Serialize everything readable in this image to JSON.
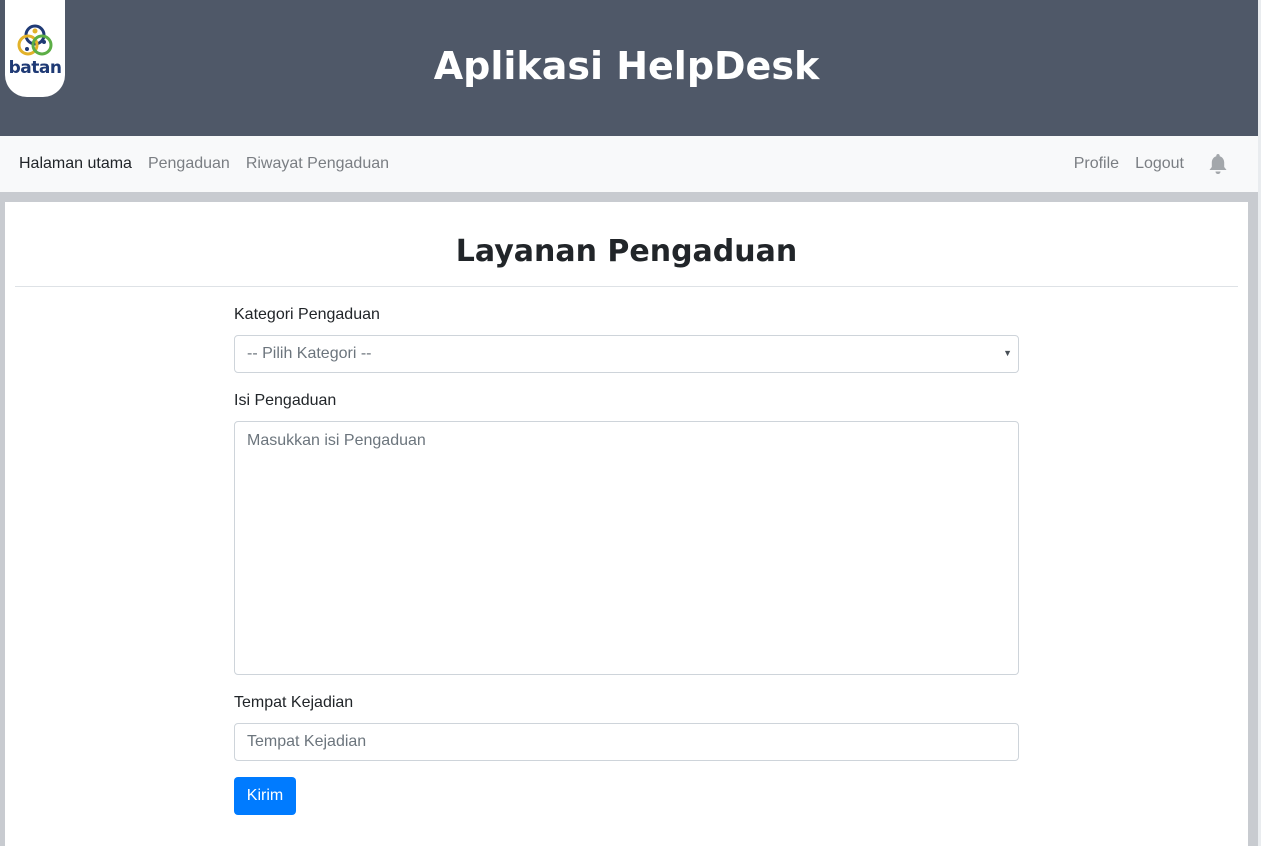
{
  "header": {
    "logo_text": "batan",
    "app_title": "Aplikasi HelpDesk"
  },
  "navbar": {
    "left_items": [
      {
        "label": "Halaman utama",
        "active": true
      },
      {
        "label": "Pengaduan",
        "active": false
      },
      {
        "label": "Riwayat Pengaduan",
        "active": false
      }
    ],
    "right_items": [
      {
        "label": "Profile"
      },
      {
        "label": "Logout"
      }
    ],
    "notification_icon": "bell-icon"
  },
  "form": {
    "title": "Layanan Pengaduan",
    "category_label": "Kategori Pengaduan",
    "category_selected": "-- Pilih Kategori --",
    "content_label": "Isi Pengaduan",
    "content_placeholder": "Masukkan isi Pengaduan",
    "location_label": "Tempat Kejadian",
    "location_placeholder": "Tempat Kejadian",
    "submit_label": "Kirim"
  },
  "colors": {
    "header_bg": "#4f5868",
    "navbar_bg": "#f8f9fa",
    "primary": "#007bff",
    "page_bg": "#c8cbd0"
  }
}
